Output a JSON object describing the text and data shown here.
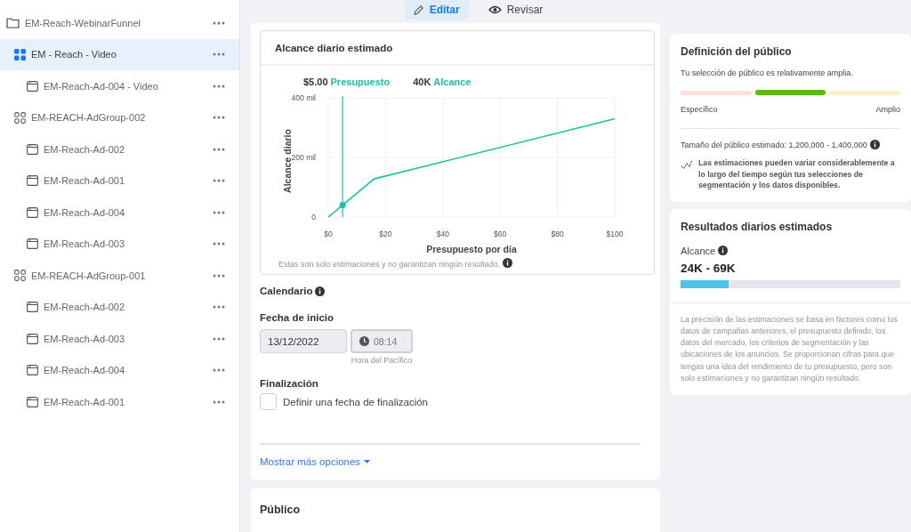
{
  "tree": [
    {
      "label": "EM-Reach-WebinarFunnel",
      "kind": "campaign",
      "selected": false,
      "children": [
        {
          "label": "EM - Reach - Video",
          "kind": "adset",
          "selected": true,
          "children": [
            {
              "label": "EM-Reach-Ad-004 - Video",
              "kind": "ad",
              "selected": false
            }
          ]
        },
        {
          "label": "EM-REACH-AdGroup-002",
          "kind": "adset",
          "selected": false,
          "children": [
            {
              "label": "EM-Reach-Ad-002",
              "kind": "ad",
              "selected": false
            },
            {
              "label": "EM-Reach-Ad-001",
              "kind": "ad",
              "selected": false
            },
            {
              "label": "EM-Reach-Ad-004",
              "kind": "ad",
              "selected": false
            },
            {
              "label": "EM-Reach-Ad-003",
              "kind": "ad",
              "selected": false
            }
          ]
        },
        {
          "label": "EM-REACH-AdGroup-001",
          "kind": "adset",
          "selected": false,
          "children": [
            {
              "label": "EM-Reach-Ad-002",
              "kind": "ad",
              "selected": false
            },
            {
              "label": "EM-Reach-Ad-003",
              "kind": "ad",
              "selected": false
            },
            {
              "label": "EM-Reach-Ad-004",
              "kind": "ad",
              "selected": false
            },
            {
              "label": "EM-Reach-Ad-001",
              "kind": "ad",
              "selected": false
            }
          ]
        }
      ]
    }
  ],
  "mode_tabs": [
    {
      "label": "Editar",
      "kind": "edit",
      "selected": true
    },
    {
      "label": "Revisar",
      "kind": "review",
      "selected": false
    }
  ],
  "reach_card": {
    "title": "Alcance diario estimado",
    "summary": [
      {
        "value": "$5.00",
        "label": "Presupuesto"
      },
      {
        "value": "40K",
        "label": "Alcance"
      }
    ],
    "chart_data": {
      "type": "line",
      "xlabel": "Presupuesto por día",
      "ylabel": "Alcance diario",
      "x": [
        0,
        5,
        16,
        100
      ],
      "series": [
        {
          "color": "#1fbf9f",
          "values": [
            0,
            40,
            128,
            330
          ]
        }
      ],
      "xlim": [
        0,
        100
      ],
      "ylim": [
        0,
        400
      ],
      "xticks": [
        {
          "value": 0,
          "label": "$0"
        },
        {
          "value": 20,
          "label": "$20"
        },
        {
          "value": 40,
          "label": "$40"
        },
        {
          "value": 60,
          "label": "$60"
        },
        {
          "value": 80,
          "label": "$80"
        },
        {
          "value": 100,
          "label": "$100"
        }
      ],
      "yticks": [
        {
          "value": 0,
          "label": "0"
        },
        {
          "value": 200,
          "label": "200 mil"
        },
        {
          "value": 400,
          "label": "400 mil"
        }
      ],
      "grid": true,
      "ref_lines": [
        {
          "axis": "x",
          "value": 5
        }
      ]
    },
    "footnote": "Estas son solo estimaciones y no garantizan ningún resultado."
  },
  "schedule": {
    "title": "Calendario",
    "start_label": "Fecha de inicio",
    "start_date": "13/12/2022",
    "start_time": "08:14",
    "timezone": "Hora del Pacífico",
    "end_label": "Finalización",
    "end_checkbox": {
      "label": "Definir una fecha de finalización",
      "checked": false
    },
    "more_link": "Mostrar más opciones"
  },
  "audience_section": {
    "title": "Público"
  },
  "audience_definition": {
    "title": "Definición del público",
    "summary": "Tu selección de público es relativamente amplia.",
    "segments": [
      {
        "color": "#fbe0de",
        "selected": false
      },
      {
        "color": "#5cb90f",
        "selected": true
      },
      {
        "color": "#fdefc8",
        "selected": false
      }
    ],
    "min_label": "Específico",
    "max_label": "Amplio",
    "size": "Tamaño del público estimado: 1,200,000 - 1,400,000",
    "note": "Las estimaciones pueden variar considerablemente a lo largo del tiempo según tus selecciones de segmentación y los datos disponibles."
  },
  "daily_results": {
    "title": "Resultados diarios estimados",
    "metric": "Alcance",
    "range": "24K - 69K",
    "level": 0.22,
    "note": "La precisión de las estimaciones se basa en factores como los datos de campañas anteriores, el presupuesto definido, los datos del mercado, los criterios de segmentación y las ubicaciones de los anuncios. Se proporcionan cifras para que tengas una idea del rendimiento de tu presupuesto, pero son solo estimaciones y no garantizan ningún resultado."
  }
}
